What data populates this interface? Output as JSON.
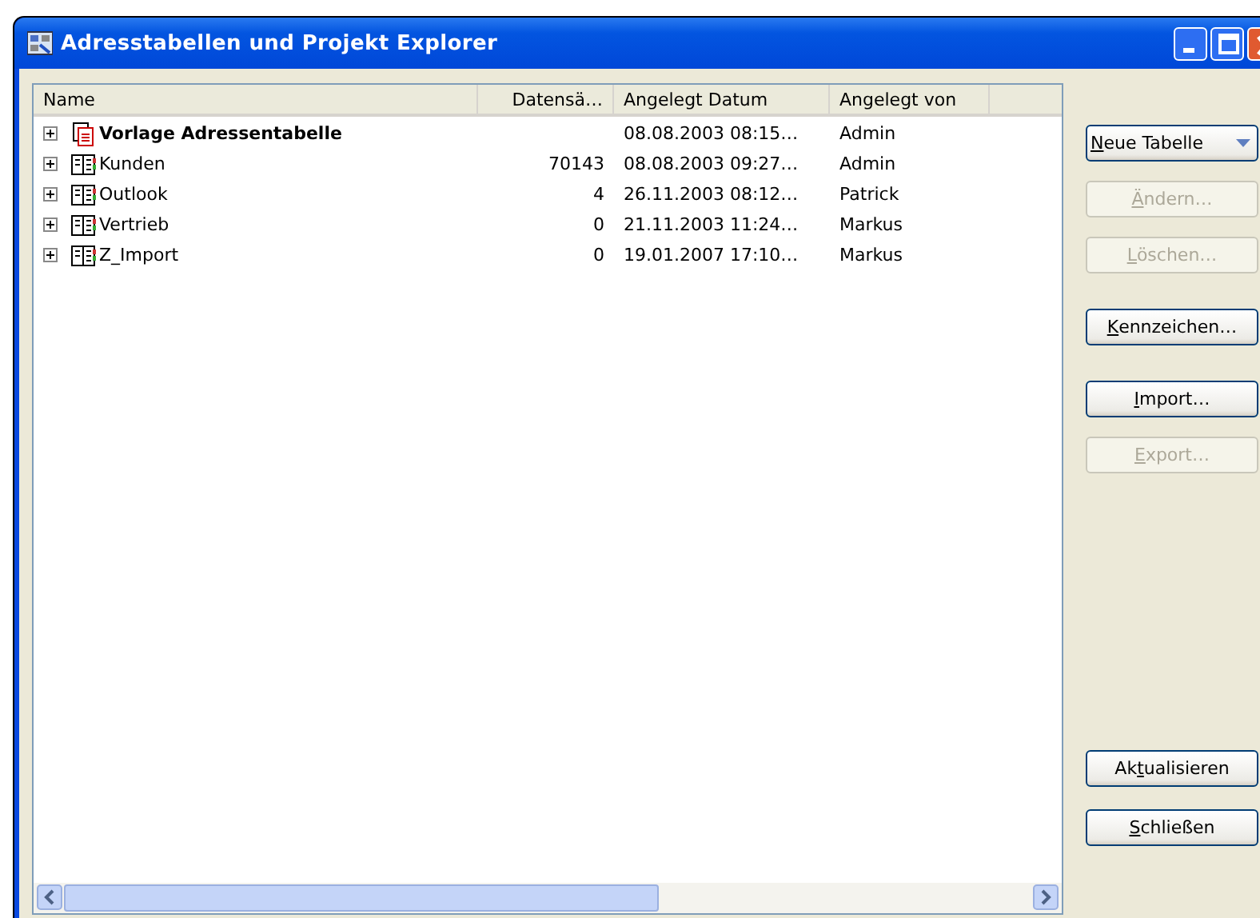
{
  "window": {
    "title": "Adresstabellen und Projekt Explorer"
  },
  "table": {
    "columns": [
      "Name",
      "Datensä…",
      "Angelegt Datum",
      "Angelegt von"
    ],
    "rows": [
      {
        "kind": "template",
        "name": "Vorlage Adressentabelle",
        "records": "",
        "created": "08.08.2003 08:15…",
        "by": "Admin"
      },
      {
        "kind": "table",
        "name": "Kunden",
        "records": "70143",
        "created": "08.08.2003 09:27…",
        "by": "Admin"
      },
      {
        "kind": "table",
        "name": "Outlook",
        "records": "4",
        "created": "26.11.2003 08:12…",
        "by": "Patrick"
      },
      {
        "kind": "table",
        "name": "Vertrieb",
        "records": "0",
        "created": "21.11.2003 11:24…",
        "by": "Markus"
      },
      {
        "kind": "table",
        "name": "Z_Import",
        "records": "0",
        "created": "19.01.2007 17:10…",
        "by": "Markus"
      }
    ]
  },
  "button_groups": [
    [
      {
        "kind": "dropdown",
        "key": "N",
        "post": "eue Tabelle",
        "disabled": false
      },
      {
        "kind": "push",
        "key": "Ä",
        "post": "ndern…",
        "disabled": true
      },
      {
        "kind": "push",
        "key": "L",
        "post": "öschen…",
        "disabled": true
      }
    ],
    [
      {
        "kind": "push",
        "key": "K",
        "post": "ennzeichen…",
        "disabled": false
      }
    ],
    [
      {
        "kind": "push",
        "key": "I",
        "post": "mport…",
        "disabled": false
      },
      {
        "kind": "push",
        "key": "E",
        "post": "xport…",
        "disabled": true
      }
    ]
  ],
  "bottom_buttons": [
    {
      "pre": "Ak",
      "key": "t",
      "post": "ualisieren",
      "disabled": false
    },
    {
      "key": "S",
      "post": "chließen",
      "disabled": false
    }
  ]
}
